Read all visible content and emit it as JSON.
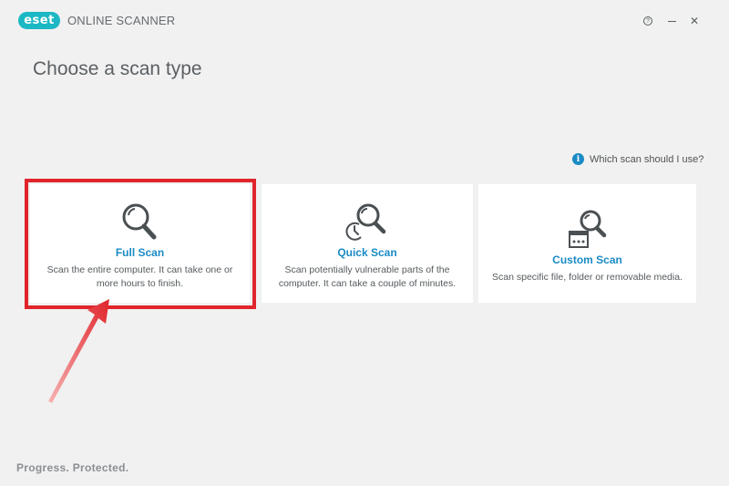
{
  "app": {
    "logo_text": "eset",
    "title": "ONLINE SCANNER"
  },
  "window_controls": {
    "help_symbol": "?",
    "close_symbol": "✕"
  },
  "page": {
    "title": "Choose a scan type",
    "help_link": "Which scan should I use?"
  },
  "scans": [
    {
      "title": "Full Scan",
      "description": "Scan the entire computer. It can take one or more hours to finish.",
      "icon": "magnifier-icon"
    },
    {
      "title": "Quick Scan",
      "description": "Scan potentially vulnerable parts of the computer. It can take a couple of minutes.",
      "icon": "quick-scan-icon"
    },
    {
      "title": "Custom Scan",
      "description": "Scan specific file, folder or removable media.",
      "icon": "custom-scan-icon"
    }
  ],
  "footer": {
    "tagline": "Progress. Protected."
  },
  "colors": {
    "accent": "#1a8bc5",
    "logo": "#1cb8c4",
    "highlight": "#e0252b",
    "background": "#f1f1f1"
  }
}
